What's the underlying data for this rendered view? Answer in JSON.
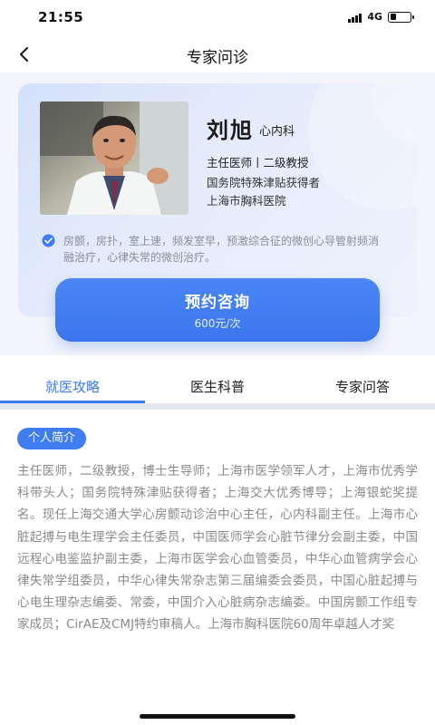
{
  "status_bar": {
    "time": "21:55",
    "network": "4G",
    "battery_level": 0.3
  },
  "nav": {
    "title": "专家问诊",
    "back_icon": "chevron-left-icon"
  },
  "doctor": {
    "name": "刘旭",
    "department": "心内科",
    "title": "主任医师丨二级教授",
    "honor": "国务院特殊津贴获得者",
    "hospital": "上海市胸科医院",
    "specialty": "房颤，房扑，室上速，频发室早，预激综合征的微创心导管射频消融治疗，心律失常的微创治疗。",
    "specialty_icon": "check-circle-icon"
  },
  "booking": {
    "label": "预约咨询",
    "price": "600元/次"
  },
  "tabs": [
    {
      "label": "就医攻略",
      "active": true
    },
    {
      "label": "医生科普",
      "active": false
    },
    {
      "label": "专家问答",
      "active": false
    }
  ],
  "intro": {
    "section_title": "个人简介",
    "bio": "主任医师，二级教授，博士生导师；上海市医学领军人才，上海市优秀学科带头人；国务院特殊津贴获得者；上海交大优秀博导；上海银蛇奖提名。现任上海交通大学心房颤动诊治中心主任，心内科副主任。上海市心脏起搏与电生理学会主任委员，中国医师学会心脏节律分会副主委，中国远程心电鉴监护副主委，上海市医学会心血管委员，中华心血管病学会心律失常学组委员，中华心律失常杂志第三届编委会委员，中国心脏起搏与心电生理杂志编委、常委，中国介入心脏病杂志编委。中国房颤工作组专家成员；CirAE及CMJ特约审稿人。上海市胸科医院60周年卓越人才奖"
  },
  "colors": {
    "accent": "#3a7bf0",
    "card_bg": "#dfe7fb"
  }
}
